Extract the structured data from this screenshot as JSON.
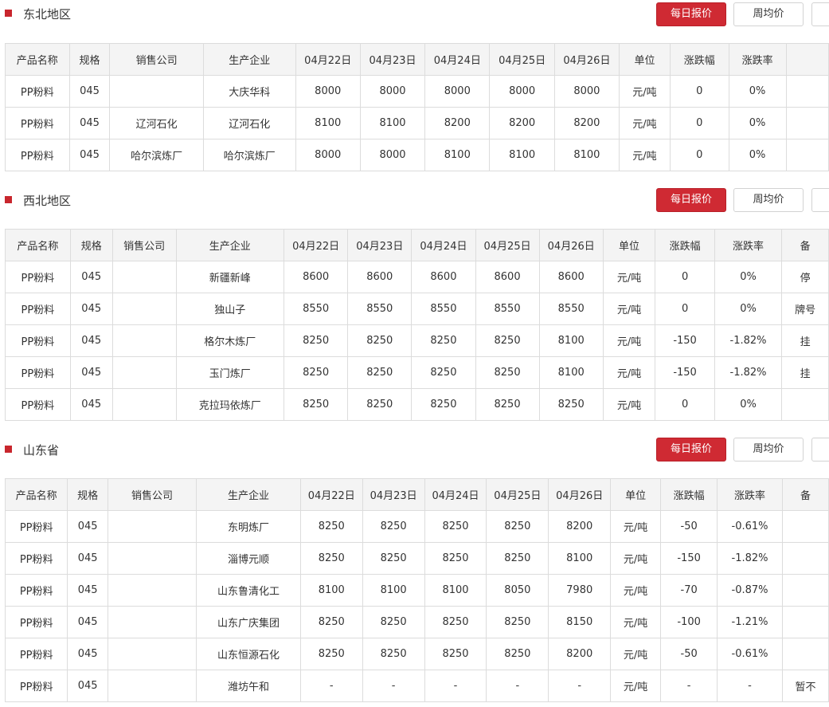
{
  "buttons": {
    "daily": "每日报价",
    "weekly": "周均价"
  },
  "colors": {
    "accent": "#cf2a33",
    "up": "#e0171f",
    "down": "#3ab43a",
    "link": "#1a5ad6"
  },
  "sections": [
    {
      "title": "东北地区",
      "headers": [
        "产品名称",
        "规格",
        "销售公司",
        "生产企业",
        "04月22日",
        "04月23日",
        "04月24日",
        "04月25日",
        "04月26日",
        "单位",
        "涨跌幅",
        "涨跌率",
        ""
      ],
      "rows": [
        [
          "PP粉料",
          "045",
          "",
          "大庆华科",
          "8000",
          "8000",
          "8000",
          "8000",
          "8000",
          "元/吨",
          "0",
          "0%",
          ""
        ],
        [
          "PP粉料",
          "045",
          "辽河石化",
          "辽河石化",
          "8100",
          "8100",
          "8200",
          "8200",
          "8200",
          "元/吨",
          "0",
          "0%",
          ""
        ],
        [
          "PP粉料",
          "045",
          "哈尔滨炼厂",
          "哈尔滨炼厂",
          "8000",
          "8000",
          "8100",
          "8100",
          "8100",
          "元/吨",
          "0",
          "0%",
          ""
        ]
      ]
    },
    {
      "title": "西北地区",
      "headers": [
        "产品名称",
        "规格",
        "销售公司",
        "生产企业",
        "04月22日",
        "04月23日",
        "04月24日",
        "04月25日",
        "04月26日",
        "单位",
        "涨跌幅",
        "涨跌率",
        "备"
      ],
      "rows": [
        [
          "PP粉料",
          "045",
          "",
          "新疆新峰",
          "8600",
          "8600",
          "8600",
          "8600",
          "8600",
          "元/吨",
          "0",
          "0%",
          "停"
        ],
        [
          "PP粉料",
          "045",
          "",
          "独山子",
          "8550",
          "8550",
          "8550",
          "8550",
          "8550",
          "元/吨",
          "0",
          "0%",
          "牌号"
        ],
        [
          "PP粉料",
          "045",
          "",
          "格尔木炼厂",
          "8250",
          "8250",
          "8250",
          "8250",
          "8100",
          "元/吨",
          "-150",
          "-1.82%",
          "挂"
        ],
        [
          "PP粉料",
          "045",
          "",
          "玉门炼厂",
          "8250",
          "8250",
          "8250",
          "8250",
          "8100",
          "元/吨",
          "-150",
          "-1.82%",
          "挂"
        ],
        [
          "PP粉料",
          "045",
          "",
          "克拉玛依炼厂",
          "8250",
          "8250",
          "8250",
          "8250",
          "8250",
          "元/吨",
          "0",
          "0%",
          ""
        ]
      ]
    },
    {
      "title": "山东省",
      "headers": [
        "产品名称",
        "规格",
        "销售公司",
        "生产企业",
        "04月22日",
        "04月23日",
        "04月24日",
        "04月25日",
        "04月26日",
        "单位",
        "涨跌幅",
        "涨跌率",
        "备"
      ],
      "rows": [
        [
          "PP粉料",
          "045",
          "",
          "东明炼厂",
          "8250",
          "8250",
          "8250",
          "8250",
          "8200",
          "元/吨",
          "-50",
          "-0.61%",
          ""
        ],
        [
          "PP粉料",
          "045",
          "",
          "淄博元顺",
          "8250",
          "8250",
          "8250",
          "8250",
          "8100",
          "元/吨",
          "-150",
          "-1.82%",
          ""
        ],
        [
          "PP粉料",
          "045",
          "",
          "山东鲁清化工",
          "8100",
          "8100",
          "8100",
          "8050",
          "7980",
          "元/吨",
          "-70",
          "-0.87%",
          ""
        ],
        [
          "PP粉料",
          "045",
          "",
          "山东广庆集团",
          "8250",
          "8250",
          "8250",
          "8250",
          "8150",
          "元/吨",
          "-100",
          "-1.21%",
          ""
        ],
        [
          "PP粉料",
          "045",
          "",
          "山东恒源石化",
          "8250",
          "8250",
          "8250",
          "8250",
          "8200",
          "元/吨",
          "-50",
          "-0.61%",
          ""
        ],
        [
          "PP粉料",
          "045",
          "",
          "潍坊午和",
          "-",
          "-",
          "-",
          "-",
          "-",
          "元/吨",
          "-",
          "-",
          "暂不"
        ]
      ]
    }
  ]
}
